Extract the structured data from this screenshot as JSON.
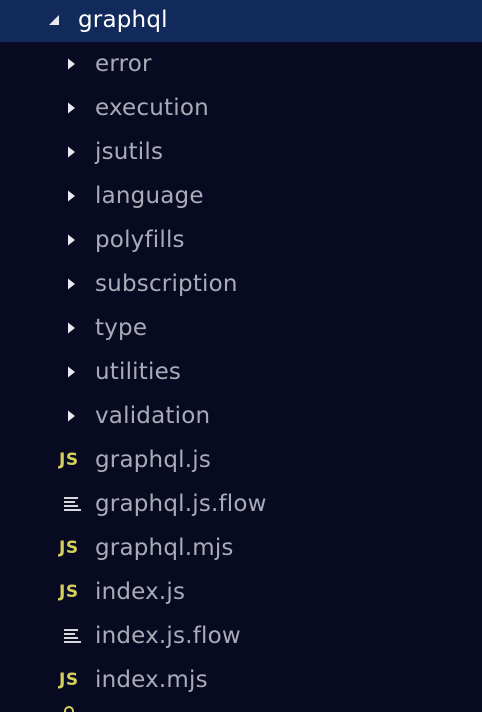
{
  "explorer": {
    "root": {
      "label": "graphql",
      "expanded": true,
      "icon": "chevron-down-icon"
    },
    "folders": [
      {
        "label": "error",
        "icon": "chevron-right-icon"
      },
      {
        "label": "execution",
        "icon": "chevron-right-icon"
      },
      {
        "label": "jsutils",
        "icon": "chevron-right-icon"
      },
      {
        "label": "language",
        "icon": "chevron-right-icon"
      },
      {
        "label": "polyfills",
        "icon": "chevron-right-icon"
      },
      {
        "label": "subscription",
        "icon": "chevron-right-icon"
      },
      {
        "label": "type",
        "icon": "chevron-right-icon"
      },
      {
        "label": "utilities",
        "icon": "chevron-right-icon"
      },
      {
        "label": "validation",
        "icon": "chevron-right-icon"
      }
    ],
    "files": [
      {
        "label": "graphql.js",
        "icon": "js-file-icon",
        "badge": "JS"
      },
      {
        "label": "graphql.js.flow",
        "icon": "text-file-icon",
        "badge": ""
      },
      {
        "label": "graphql.mjs",
        "icon": "js-file-icon",
        "badge": "JS"
      },
      {
        "label": "index.js",
        "icon": "js-file-icon",
        "badge": "JS"
      },
      {
        "label": "index.js.flow",
        "icon": "text-file-icon",
        "badge": ""
      },
      {
        "label": "index.mjs",
        "icon": "js-file-icon",
        "badge": "JS"
      }
    ]
  },
  "colors": {
    "background": "#080a22",
    "selected_row": "#12295c",
    "label_text": "#a9acb8",
    "selected_text": "#ffffff",
    "js_badge": "#d6cf5b",
    "twisty": "#e8e9ee"
  }
}
